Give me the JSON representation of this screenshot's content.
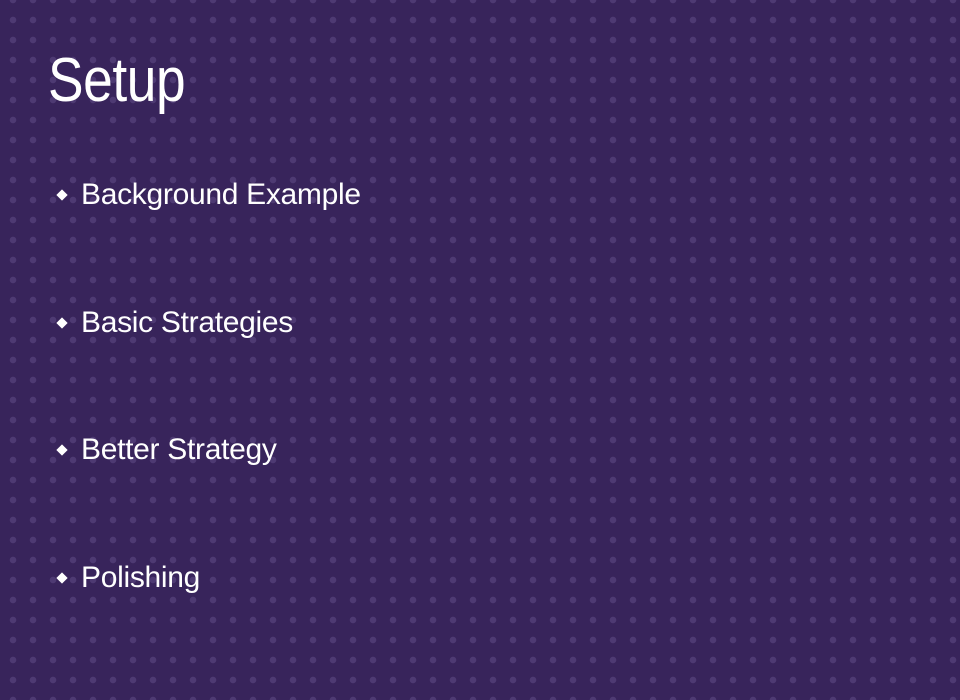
{
  "slide": {
    "title": "Setup",
    "items": [
      {
        "label": "Background Example"
      },
      {
        "label": "Basic Strategies"
      },
      {
        "label": "Better Strategy"
      },
      {
        "label": "Polishing"
      }
    ],
    "bullet_icon": "diamond-icon",
    "colors": {
      "background": "#38245b",
      "text": "#ffffff"
    }
  }
}
